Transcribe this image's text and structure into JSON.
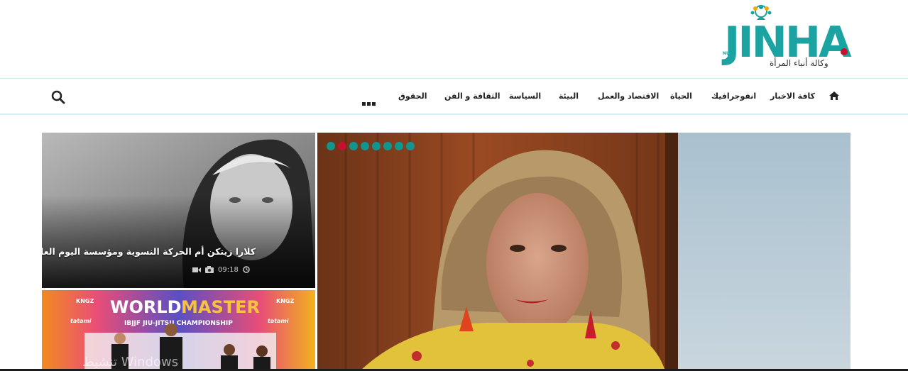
{
  "logo": {
    "name": "JINHA",
    "tagline": "وكالة أنباء المرأة",
    "prefix": "NU",
    "brand_color": "#1aa3a0",
    "dot_color": "#c8102e"
  },
  "nav": {
    "home_icon": "home-icon",
    "items": [
      "كافة الاخبار",
      "انفوجرافيك",
      "الحياة",
      "الاقتصاد والعمل",
      "البيئة",
      "السياسة",
      "الثقافة و الفن",
      "الحقوق"
    ],
    "more_icon": "more-icon",
    "search_icon": "search-icon"
  },
  "slider": {
    "dot_count": 8,
    "active_index": 1,
    "dot_color": "#13958f",
    "active_color": "#c8102e"
  },
  "cards": [
    {
      "title": "كلارا زيتكن أم الحركة النسوية ومؤسسة اليوم العالمي للمرأة",
      "time": "09:18",
      "icons": [
        "video-icon",
        "camera-icon",
        "clock-icon"
      ]
    },
    {
      "banner_title_1": "WORLD",
      "banner_title_2": "MASTER",
      "banner_subtitle": "IBJJF JIU-JITSU CHAMPIONSHIP",
      "logo_1": "KNGZ",
      "logo_2": "tatami"
    }
  ],
  "watermark": "تنشيط Windows"
}
